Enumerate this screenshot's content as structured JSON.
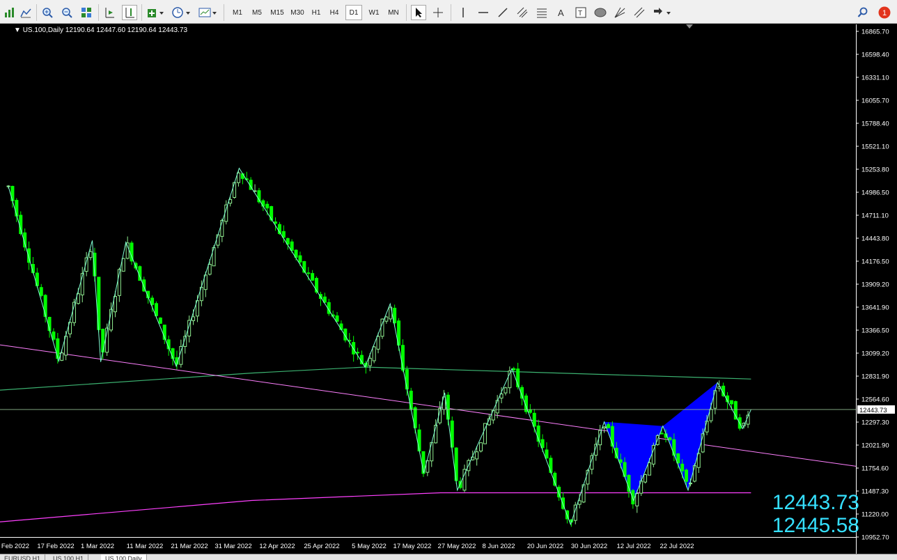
{
  "toolbar": {
    "timeframes": [
      "M1",
      "M5",
      "M15",
      "M30",
      "H1",
      "H4",
      "D1",
      "W1",
      "MN"
    ],
    "active_timeframe": "D1",
    "notification_count": "1"
  },
  "chart_info": {
    "symbol": "US.100,Daily",
    "ohlc": "12190.64 12447.60 12190.64 12443.73"
  },
  "price_scale": [
    "16865.70",
    "16598.40",
    "16331.10",
    "16055.70",
    "15788.40",
    "15521.10",
    "15253.80",
    "14986.50",
    "14711.10",
    "14443.80",
    "14176.50",
    "13909.20",
    "13641.90",
    "13366.50",
    "13099.20",
    "12831.90",
    "12564.60",
    "12297.30",
    "12021.90",
    "11754.60",
    "11487.30",
    "11220.00",
    "10952.70"
  ],
  "current_price_label": "12443.73",
  "date_axis": [
    "Feb 2022",
    "17 Feb 2022",
    "1 Mar 2022",
    "11 Mar 2022",
    "21 Mar 2022",
    "31 Mar 2022",
    "12 Apr 2022",
    "25 Apr 2022",
    "5 May 2022",
    "17 May 2022",
    "27 May 2022",
    "8 Jun 2022",
    "20 Jun 2022",
    "30 Jun 2022",
    "12 Jul 2022",
    "22 Jul 2022"
  ],
  "big_readout": {
    "bid": "12443.73",
    "ask": "12445.58"
  },
  "bottom_tabs": [
    "EURUSD,H1",
    "US.100,H1",
    "US.100,Daily"
  ],
  "colors": {
    "bull": "#90ee90",
    "bear": "#00ff00",
    "zigzag": "#7fffd4",
    "trendline": "#ff80ff",
    "ma_green": "#3cb371",
    "ma_magenta": "#ff40ff",
    "pattern": "#0000ff",
    "readout": "#35e0ff"
  },
  "chart_data": {
    "type": "candlestick",
    "symbol": "US.100",
    "timeframe": "Daily",
    "y_range": [
      10952.7,
      16865.7
    ],
    "zigzag": [
      {
        "date": "2022-02-02",
        "price": 15050
      },
      {
        "date": "2022-02-14",
        "price": 13010
      },
      {
        "date": "2022-02-22",
        "price": 14420
      },
      {
        "date": "2022-02-24",
        "price": 13000
      },
      {
        "date": "2022-03-02",
        "price": 14400
      },
      {
        "date": "2022-03-14",
        "price": 12950
      },
      {
        "date": "2022-03-29",
        "price": 15265
      },
      {
        "date": "2022-04-28",
        "price": 12940
      },
      {
        "date": "2022-05-04",
        "price": 13680
      },
      {
        "date": "2022-05-12",
        "price": 11700
      },
      {
        "date": "2022-05-17",
        "price": 12640
      },
      {
        "date": "2022-05-20",
        "price": 11500
      },
      {
        "date": "2022-06-02",
        "price": 12920
      },
      {
        "date": "2022-06-16",
        "price": 11100
      },
      {
        "date": "2022-06-24",
        "price": 12300
      },
      {
        "date": "2022-07-01",
        "price": 11380
      },
      {
        "date": "2022-07-08",
        "price": 12250
      },
      {
        "date": "2022-07-14",
        "price": 11500
      },
      {
        "date": "2022-07-21",
        "price": 12760
      },
      {
        "date": "2022-07-27",
        "price": 12220
      },
      {
        "date": "2022-07-29",
        "price": 12443.73
      }
    ],
    "harmonic_pattern": [
      {
        "date": "2022-06-24",
        "price": 12300
      },
      {
        "date": "2022-07-01",
        "price": 11380
      },
      {
        "date": "2022-07-08",
        "price": 12250
      },
      {
        "date": "2022-07-14",
        "price": 11500
      },
      {
        "date": "2022-07-21",
        "price": 12760
      }
    ],
    "trendline": [
      {
        "date": "2022-01-31",
        "price": 13200
      },
      {
        "date": "2022-08-23",
        "price": 11780
      }
    ],
    "moving_averages": [
      {
        "name": "",
        "points": [
          {
            "date": "2022-01-31",
            "price": 12670
          },
          {
            "date": "2022-04-01",
            "price": 12870
          },
          {
            "date": "2022-04-28",
            "price": 12940
          },
          {
            "date": "2022-07-29",
            "price": 12800
          }
        ]
      },
      {
        "name": "",
        "points": [
          {
            "date": "2022-01-31",
            "price": 11130
          },
          {
            "date": "2022-04-01",
            "price": 11380
          },
          {
            "date": "2022-05-16",
            "price": 11470
          },
          {
            "date": "2022-07-29",
            "price": 11470
          }
        ]
      }
    ],
    "last_candle": {
      "date": "2022-07-29",
      "open": 12190.64,
      "high": 12447.6,
      "low": 12190.64,
      "close": 12443.73
    }
  }
}
